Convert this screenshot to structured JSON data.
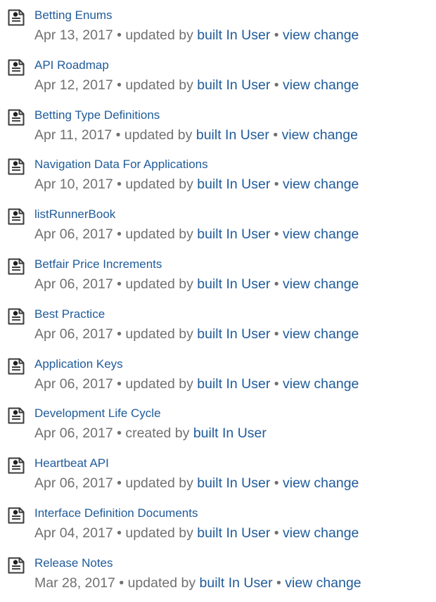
{
  "items": [
    {
      "title": "Betting Enums",
      "date": "Apr 13, 2017",
      "action": "updated by",
      "user": "built In User",
      "change": "view change"
    },
    {
      "title": "API Roadmap",
      "date": "Apr 12, 2017",
      "action": "updated by",
      "user": "built In User",
      "change": "view change"
    },
    {
      "title": "Betting Type Definitions",
      "date": "Apr 11, 2017",
      "action": "updated by",
      "user": "built In User",
      "change": "view change"
    },
    {
      "title": "Navigation Data For Applications",
      "date": "Apr 10, 2017",
      "action": "updated by",
      "user": "built In User",
      "change": "view change"
    },
    {
      "title": "listRunnerBook",
      "date": "Apr 06, 2017",
      "action": "updated by",
      "user": "built In User",
      "change": "view change"
    },
    {
      "title": "Betfair Price Increments",
      "date": "Apr 06, 2017",
      "action": "updated by",
      "user": "built In User",
      "change": "view change"
    },
    {
      "title": "Best Practice",
      "date": "Apr 06, 2017",
      "action": "updated by",
      "user": "built In User",
      "change": "view change"
    },
    {
      "title": "Application Keys",
      "date": "Apr 06, 2017",
      "action": "updated by",
      "user": "built In User",
      "change": "view change"
    },
    {
      "title": "Development Life Cycle",
      "date": "Apr 06, 2017",
      "action": "created by",
      "user": "built In User",
      "change": null
    },
    {
      "title": "Heartbeat API",
      "date": "Apr 06, 2017",
      "action": "updated by",
      "user": "built In User",
      "change": "view change"
    },
    {
      "title": "Interface Definition Documents",
      "date": "Apr 04, 2017",
      "action": "updated by",
      "user": "built In User",
      "change": "view change"
    },
    {
      "title": "Release Notes",
      "date": "Mar 28, 2017",
      "action": "updated by",
      "user": "built In User",
      "change": "view change"
    }
  ],
  "separator": "•",
  "icon": "page-icon",
  "colors": {
    "link": "#1f5b9a",
    "meta": "#707070",
    "icon_stroke": "#3a3a3a"
  }
}
